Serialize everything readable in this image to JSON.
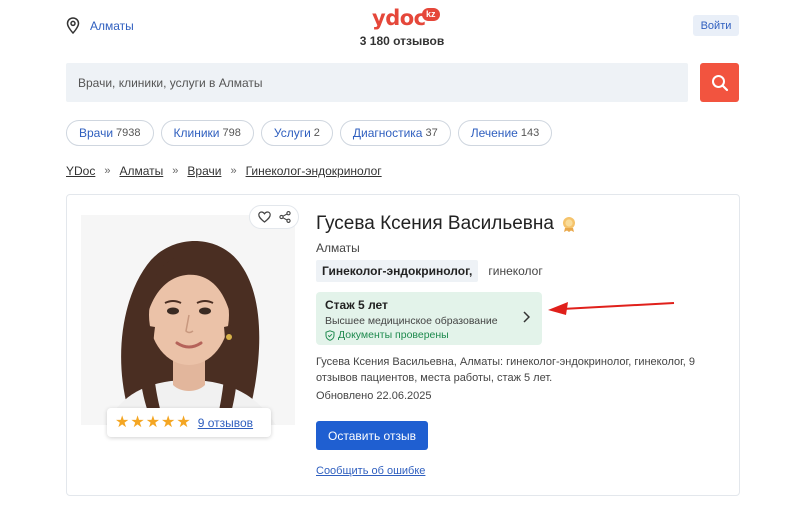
{
  "header": {
    "city": "Алматы",
    "logo_text": "ydoc",
    "logo_badge": "kz",
    "reviews_count": "3 180 отзывов",
    "login_label": "Войти"
  },
  "search": {
    "placeholder": "Врачи, клиники, услуги в Алматы"
  },
  "chips": [
    {
      "label": "Врачи",
      "count": "7938"
    },
    {
      "label": "Клиники",
      "count": "798"
    },
    {
      "label": "Услуги",
      "count": "2"
    },
    {
      "label": "Диагностика",
      "count": "37"
    },
    {
      "label": "Лечение",
      "count": "143"
    }
  ],
  "breadcrumb": [
    "YDoc",
    "Алматы",
    "Врачи",
    "Гинеколог-эндокринолог"
  ],
  "breadcrumb_sep": "»",
  "doctor": {
    "name": "Гусева Ксения Васильевна",
    "city": "Алматы",
    "specialty_main": "Гинеколог-эндокринолог,",
    "specialty_sub": "гинеколог",
    "rating_stars": 5,
    "reviews_link": "9 отзывов",
    "experience_title": "Стаж 5 лет",
    "education": "Высшее медицинское образование",
    "verified": "Документы проверены",
    "description": "Гусева Ксения Васильевна, Алматы: гинеколог-эндокринолог, гинеколог, 9 отзывов пациентов, места работы, стаж 5 лет.",
    "updated": "Обновлено 22.06.2025",
    "review_button": "Оставить отзыв",
    "report_link": "Сообщить об ошибке"
  },
  "colors": {
    "brand": "#e5473a",
    "link": "#2f5fbf",
    "primary_button": "#1f5fd1",
    "experience_bg": "#e3f3ea",
    "verified": "#1e8a4e",
    "star": "#f4a623",
    "annotation_arrow": "#e0201b"
  },
  "icons": {
    "location": "location-pin-icon",
    "search": "search-icon",
    "favorite": "heart-icon",
    "share": "share-icon",
    "badge": "medal-icon",
    "verified": "shield-check-icon",
    "chevron": "chevron-right-icon"
  }
}
